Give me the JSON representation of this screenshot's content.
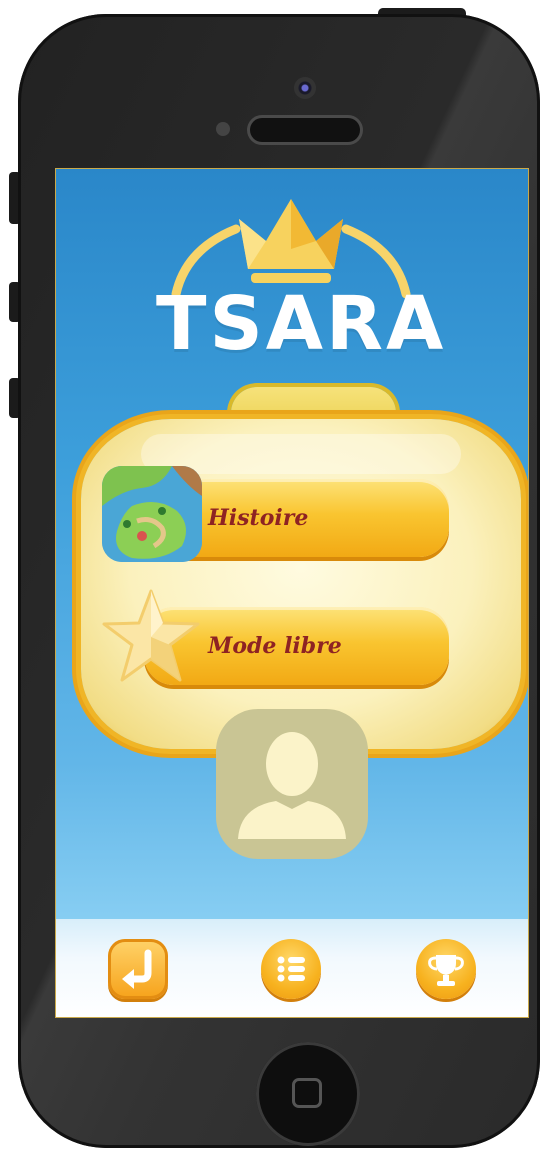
{
  "app": {
    "title": "TSARA"
  },
  "menu": {
    "buttons": [
      {
        "label": "Histoire",
        "icon": "map-icon"
      },
      {
        "label": "Mode libre",
        "icon": "star-icon"
      }
    ]
  },
  "profile": {
    "icon": "user-silhouette-icon"
  },
  "bottom_bar": {
    "buttons": [
      {
        "icon": "back-arrow-icon"
      },
      {
        "icon": "list-icon"
      },
      {
        "icon": "trophy-icon"
      }
    ]
  },
  "colors": {
    "sky_top": "#2a87c9",
    "sky_bottom": "#a6dcf7",
    "button_gold": "#f9c530",
    "button_text": "#8e2323",
    "panel_cream": "#fbf1bd"
  }
}
